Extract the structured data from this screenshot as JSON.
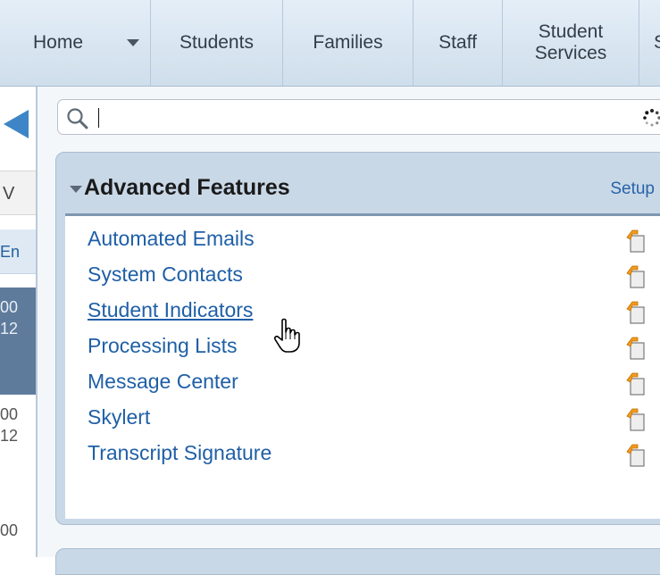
{
  "nav": {
    "home": "Home",
    "students": "Students",
    "families": "Families",
    "staff": "Staff",
    "services_line1": "Student",
    "services_line2": "Services",
    "partial": "S"
  },
  "left": {
    "v": "V",
    "en": "En",
    "sel_line1": "00",
    "sel_line2": "12",
    "row1_line1": "00",
    "row1_line2": "12",
    "row2": "00"
  },
  "search": {
    "value": "",
    "placeholder": ""
  },
  "features": {
    "title": "Advanced Features",
    "setup": "Setup",
    "items": [
      {
        "label": "Automated Emails"
      },
      {
        "label": "System Contacts"
      },
      {
        "label": "Student Indicators"
      },
      {
        "label": "Processing Lists"
      },
      {
        "label": "Message Center"
      },
      {
        "label": "Skylert"
      },
      {
        "label": "Transcript Signature"
      }
    ]
  },
  "icons": {
    "search": "search-icon",
    "spinner": "loading-spinner-icon",
    "collapse": "chevron-down-icon",
    "copy": "copy-to-clipboard-icon",
    "cursor": "hand-pointer-cursor-icon"
  },
  "colors": {
    "link": "#1f5fa6",
    "header_bg": "#c9d8e7",
    "nav_bg": "#d9e6f2",
    "accent_arrow": "#3d85c6",
    "icon_orange": "#f29b1d"
  }
}
